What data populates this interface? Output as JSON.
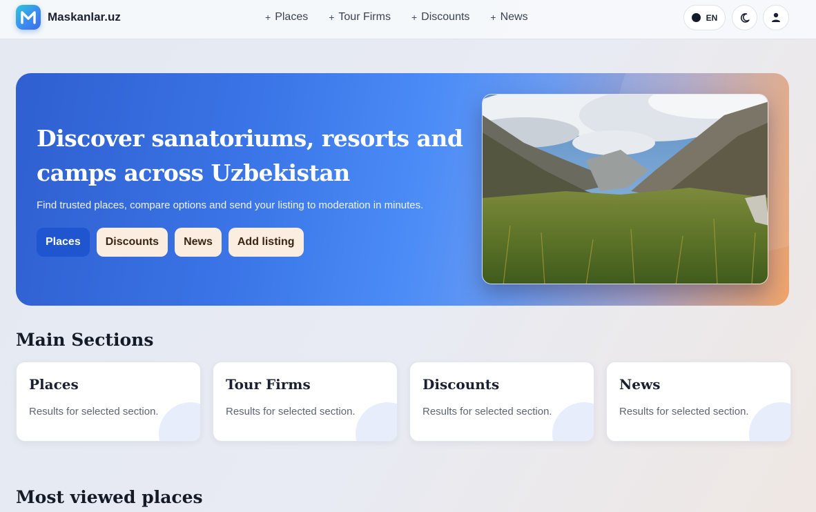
{
  "header": {
    "brand": "Maskanlar.uz",
    "nav": [
      {
        "label": "Places"
      },
      {
        "label": "Tour Firms"
      },
      {
        "label": "Discounts"
      },
      {
        "label": "News"
      }
    ],
    "language": "EN"
  },
  "hero": {
    "title": "Discover sanatoriums, resorts and camps across Uzbekistan",
    "subtitle": "Find trusted places, compare options and send your listing to moderation in minutes.",
    "buttons": [
      {
        "label": "Places"
      },
      {
        "label": "Discounts"
      },
      {
        "label": "News"
      },
      {
        "label": "Add listing"
      }
    ]
  },
  "main_sections": {
    "title": "Main Sections",
    "cards": [
      {
        "title": "Places",
        "description": "Results for selected section."
      },
      {
        "title": "Tour Firms",
        "description": "Results for selected section."
      },
      {
        "title": "Discounts",
        "description": "Results for selected section."
      },
      {
        "title": "News",
        "description": "Results for selected section."
      }
    ]
  },
  "most_viewed": {
    "title": "Most viewed places"
  },
  "colors": {
    "primary": "#1f56cf",
    "hero_start": "#2f5fd0",
    "hero_end": "#f0a46a",
    "soft_button": "#fbeee0"
  },
  "icons": [
    "logo-m-icon",
    "plus-icon",
    "moon-icon",
    "user-icon"
  ]
}
